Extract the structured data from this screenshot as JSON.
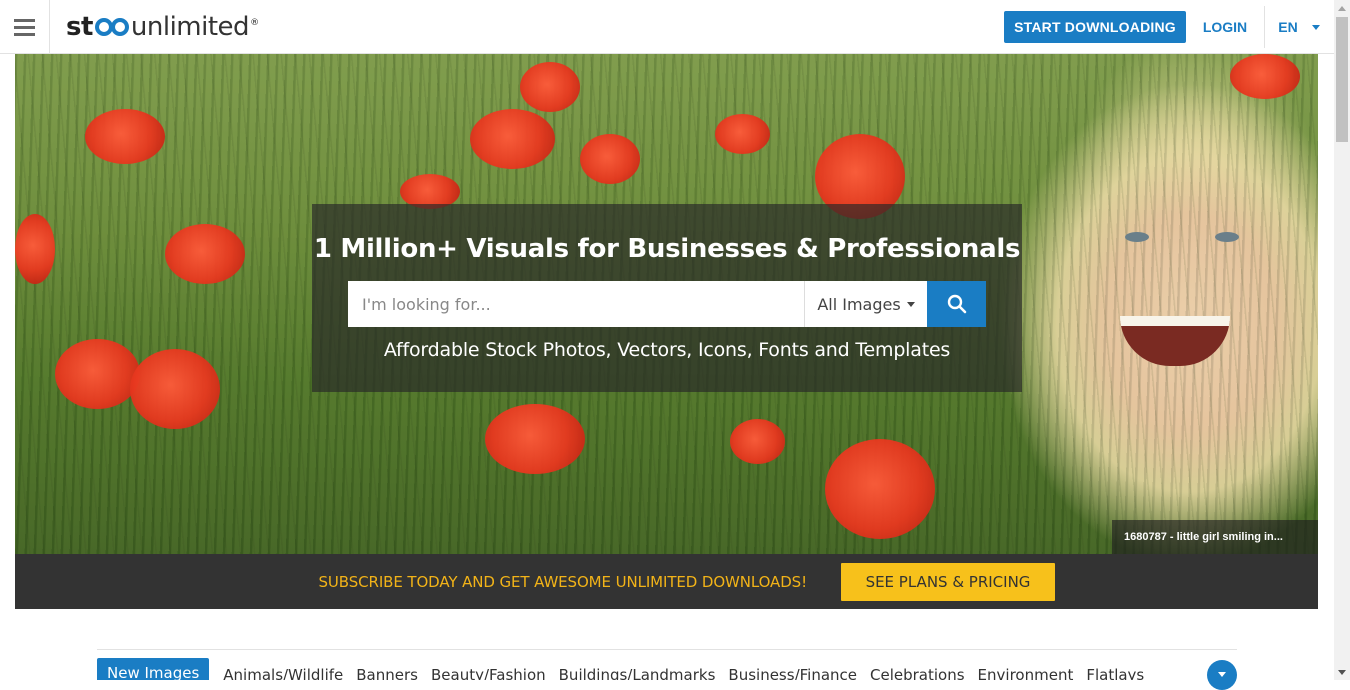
{
  "header": {
    "logo": {
      "part1": "st",
      "part2": "unlimited",
      "reg": "®"
    },
    "start_label": "START DOWNLOADING",
    "login_label": "LOGIN",
    "lang_label": "EN"
  },
  "hero": {
    "title": "1 Million+ Visuals for Businesses & Professionals",
    "search_placeholder": "I'm looking for...",
    "filter_selected": "All Images",
    "subtitle": "Affordable Stock Photos, Vectors, Icons, Fonts and Templates",
    "caption": "1680787 - little girl smiling in..."
  },
  "promo": {
    "text": "SUBSCRIBE TODAY AND GET AWESOME UNLIMITED DOWNLOADS!",
    "button_label": "SEE PLANS & PRICING"
  },
  "categories": {
    "items": [
      "New Images",
      "Animals/Wildlife",
      "Banners",
      "Beauty/Fashion",
      "Buildings/Landmarks",
      "Business/Finance",
      "Celebrations",
      "Environment",
      "Flatlays"
    ]
  },
  "colors": {
    "brand_blue": "#1a7dc4",
    "promo_yellow": "#f7c11b",
    "promo_text": "#f2b318",
    "promo_bg": "#333333"
  }
}
